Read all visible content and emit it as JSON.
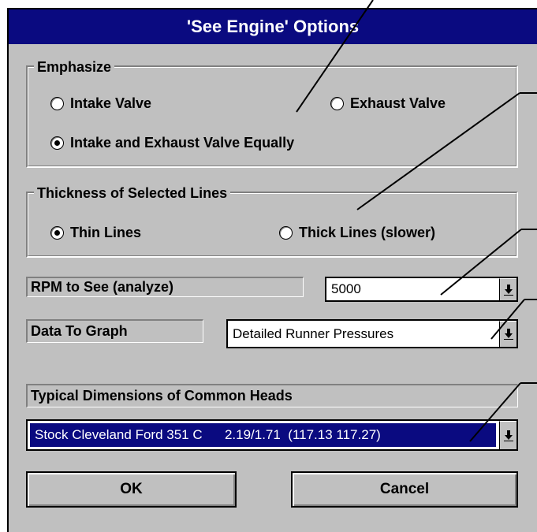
{
  "dialog": {
    "title": "'See Engine' Options"
  },
  "emphasize": {
    "legend": "Emphasize",
    "options": [
      {
        "label": "Intake Valve",
        "selected": false
      },
      {
        "label": "Exhaust Valve",
        "selected": false
      },
      {
        "label": "Intake and Exhaust Valve Equally",
        "selected": true
      }
    ]
  },
  "thickness": {
    "legend": "Thickness of Selected Lines",
    "options": [
      {
        "label": "Thin Lines",
        "selected": true
      },
      {
        "label": "Thick Lines (slower)",
        "selected": false
      }
    ]
  },
  "rpm": {
    "label": "RPM to See (analyze)",
    "value": "5000"
  },
  "graph": {
    "label": "Data To Graph",
    "value": "Detailed Runner Pressures"
  },
  "heads": {
    "label": "Typical Dimensions of Common Heads",
    "value": "Stock Cleveland Ford 351 C      2.19/1.71  (117.13 117.27)"
  },
  "buttons": {
    "ok": "OK",
    "cancel": "Cancel"
  },
  "colors": {
    "titlebar": "#0a0a80",
    "face": "#c0c0c0",
    "selection": "#0a0a80"
  },
  "icons": {
    "dropdown": "dropdown-arrow-icon"
  }
}
